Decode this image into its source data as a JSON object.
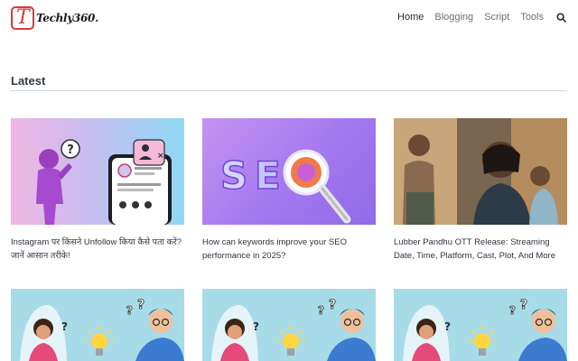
{
  "site": {
    "logo_text": "Techly360.",
    "nav": [
      {
        "label": "Home"
      },
      {
        "label": "Blogging"
      },
      {
        "label": "Script"
      },
      {
        "label": "Tools"
      }
    ],
    "search_icon": "search-icon"
  },
  "section": {
    "title": "Latest"
  },
  "cards": [
    {
      "title": "Instagram पर किसने Unfollow किया कैसे पता करें? जानें आसान तरीके!",
      "thumb": "instagram-unfollow-illustration"
    },
    {
      "title": "How can keywords improve your SEO performance in 2025?",
      "thumb": "seo-magnifier-illustration"
    },
    {
      "title": "Lubber Pandhu OTT Release: Streaming Date, Time, Platform, Cast, Plot, And More",
      "thumb": "movie-still-photo"
    },
    {
      "title": "",
      "thumb": "thinking-people-illustration"
    },
    {
      "title": "",
      "thumb": "thinking-people-illustration"
    },
    {
      "title": "",
      "thumb": "thinking-people-illustration"
    }
  ],
  "colors": {
    "accent": "#d93a3a",
    "nav_text": "#6b6f7a",
    "rule": "#cfd8e0"
  }
}
